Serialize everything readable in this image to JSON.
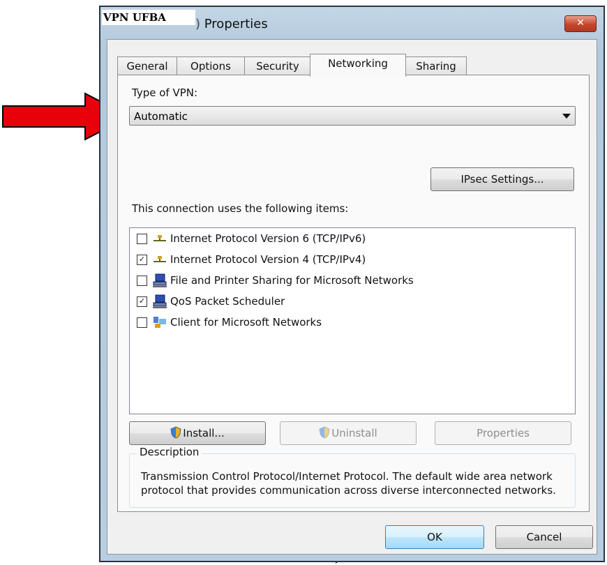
{
  "window": {
    "title_overlay": "VPN UFBA",
    "title_suffix": "Properties",
    "close_glyph": "✕"
  },
  "tabs": [
    {
      "label": "General"
    },
    {
      "label": "Options"
    },
    {
      "label": "Security"
    },
    {
      "label": "Networking"
    },
    {
      "label": "Sharing"
    }
  ],
  "vpn": {
    "type_label": "Type of VPN:",
    "type_value": "Automatic",
    "ipsec_button": "IPsec Settings..."
  },
  "items": {
    "heading": "This connection uses the following items:",
    "list": [
      {
        "label": "Internet Protocol Version 6 (TCP/IPv6)",
        "checked": false,
        "icon": "network-protocol-icon"
      },
      {
        "label": "Internet Protocol Version 4 (TCP/IPv4)",
        "checked": true,
        "icon": "network-protocol-icon"
      },
      {
        "label": "File and Printer Sharing for Microsoft Networks",
        "checked": false,
        "icon": "computer-network-icon"
      },
      {
        "label": "QoS Packet Scheduler",
        "checked": true,
        "icon": "computer-network-icon"
      },
      {
        "label": "Client for Microsoft Networks",
        "checked": false,
        "icon": "network-client-icon"
      }
    ]
  },
  "buttons": {
    "install": "Install...",
    "uninstall": "Uninstall",
    "properties": "Properties",
    "ok": "OK",
    "cancel": "Cancel"
  },
  "description": {
    "legend": "Description",
    "text": "Transmission Control Protocol/Internet Protocol. The default wide area network protocol that provides communication across diverse interconnected networks."
  },
  "colors": {
    "arrow": "#e8000b",
    "close_button": "#c6462c"
  }
}
